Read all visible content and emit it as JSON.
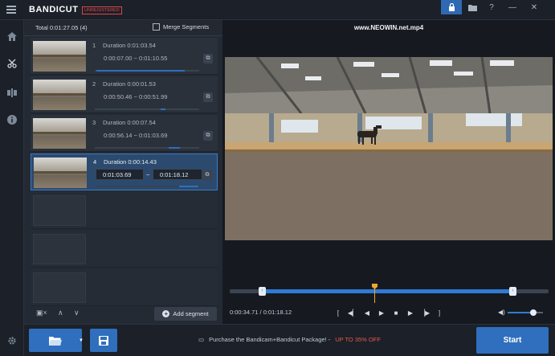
{
  "app": {
    "brand": "BANDICUT",
    "badge": "UNREGISTERED"
  },
  "titlebar_icons": [
    {
      "name": "lock-icon",
      "glyph": "🔒"
    },
    {
      "name": "folder-icon",
      "glyph": "▰"
    },
    {
      "name": "help-icon",
      "glyph": "?"
    },
    {
      "name": "minimize-icon",
      "glyph": "—"
    },
    {
      "name": "close-icon",
      "glyph": "✕"
    }
  ],
  "rail": {
    "icons": [
      "home-icon",
      "cut-icon",
      "split-icon",
      "info-icon",
      "settings-icon"
    ]
  },
  "segments_panel": {
    "total": "Total 0:01:27.05 (4)",
    "merge_label": "Merge Segments",
    "merge_checked": false,
    "segments": [
      {
        "num": "1",
        "duration": "Duration 0:01:03.54",
        "range": "0:00:07.00  ~  0:01:10.55",
        "progress": 0.85
      },
      {
        "num": "2",
        "duration": "Duration 0:00:01.53",
        "range": "0:00:50.46  ~  0:00:51.99",
        "progress": 0.04
      },
      {
        "num": "3",
        "duration": "Duration 0:00:07.54",
        "range": "0:00:56.14  ~  0:01:03.69",
        "progress": 0.1
      },
      {
        "num": "4",
        "duration": "Duration 0:00:14.43",
        "start": "0:01:03.69",
        "end": "0:01:18.12",
        "separator": "~",
        "progress": 0.18
      }
    ],
    "add_segment_label": "Add segment"
  },
  "preview": {
    "filename": "www.NEOWIN.net.mp4",
    "time_readout": "0:00:34.71 / 0:01:18.12",
    "selection_start_frac": 0.1,
    "selection_end_frac": 0.89,
    "playhead_frac": 0.455,
    "volume_frac": 0.75
  },
  "bottom": {
    "promo_text": "Purchase the Bandicam+Bandicut Package! -",
    "promo_highlight": "UP TO 35% OFF",
    "start_label": "Start"
  }
}
